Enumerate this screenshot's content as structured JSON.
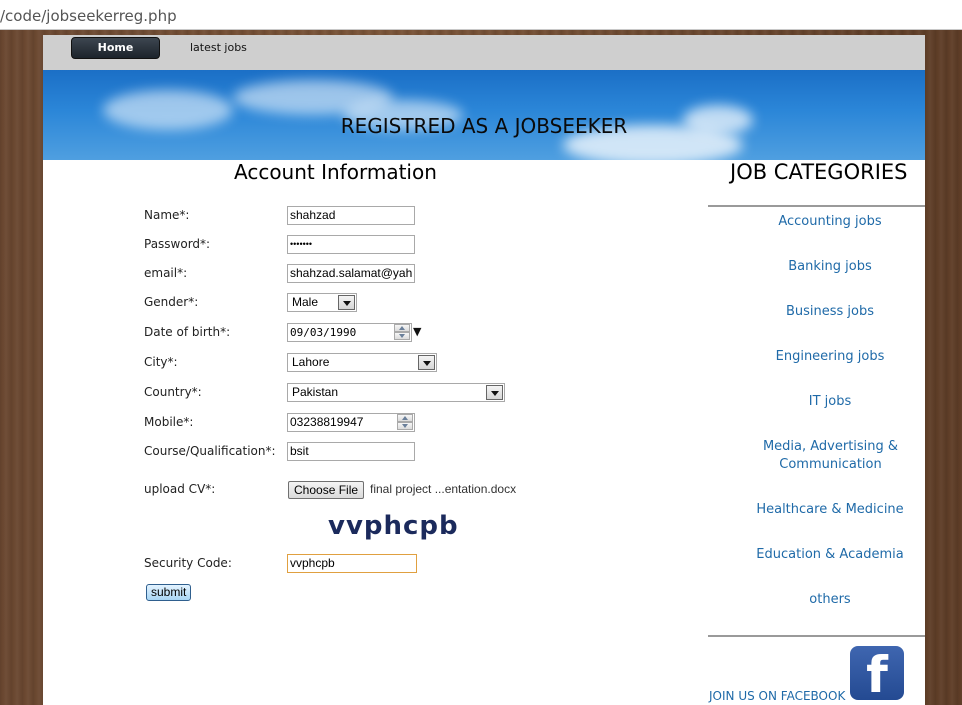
{
  "browser": {
    "url": "/code/jobseekerreg.php"
  },
  "nav": {
    "home_label": "Home",
    "latest_label": "latest jobs"
  },
  "banner": {
    "title": "REGISTRED AS A JOBSEEKER"
  },
  "form": {
    "title": "Account Information",
    "name_label": "Name*:",
    "name_value": "shahzad",
    "password_label": "Password*:",
    "password_value": "•••••••",
    "email_label": "email*:",
    "email_value": "shahzad.salamat@yah",
    "gender_label": "Gender*:",
    "gender_value": "Male",
    "dob_label": "Date of birth*:",
    "dob_value": "09/03/1990",
    "city_label": "City*:",
    "city_value": "Lahore",
    "country_label": "Country*:",
    "country_value": "Pakistan",
    "mobile_label": "Mobile*:",
    "mobile_value": "03238819947",
    "course_label": "Course/Qualification*:",
    "course_value": "bsit",
    "cv_label": "upload CV*:",
    "choose_file_label": "Choose File",
    "file_name": "final project ...entation.docx",
    "captcha_text": "vvphcpb",
    "security_label": "Security Code:",
    "security_value": "vvphcpb",
    "submit_label": "submit"
  },
  "sidebar": {
    "title": "JOB CATEGORIES",
    "categories": [
      "Accounting jobs",
      "Banking jobs",
      "Business jobs",
      "Engineering jobs",
      "IT jobs",
      "Media, Advertising & Communication",
      "Healthcare & Medicine",
      "Education & Academia",
      "others"
    ],
    "facebook_text": "JOIN US ON FACEBOOK",
    "facebook_logo": "f"
  },
  "colors": {
    "link": "#1f6aa8",
    "banner": "#2b86d8",
    "nav_button": "#1c232b"
  }
}
